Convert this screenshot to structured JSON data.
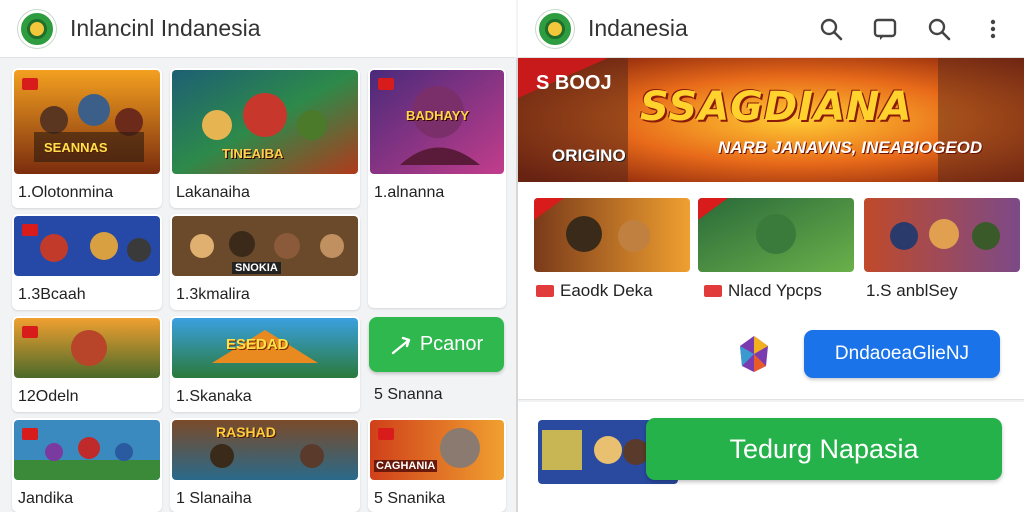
{
  "left_header": {
    "title": "Inlancinl Indanesia"
  },
  "right_header": {
    "title": "Indanesia"
  },
  "actions": [
    {
      "icon": "search-icon"
    },
    {
      "icon": "chat-icon"
    },
    {
      "icon": "search-icon"
    },
    {
      "icon": "more-vert-icon"
    }
  ],
  "grid": [
    {
      "label": "1.Olotonmina",
      "thumb_text": "SEANNAS"
    },
    {
      "label": "Lakanaiha",
      "thumb_text": "TINEAIBA"
    },
    {
      "label": "1.alnanna",
      "thumb_text": "BADHAYY"
    },
    {
      "label": "1.3Bcaah",
      "thumb_text": ""
    },
    {
      "label": "1.3kmalira",
      "thumb_text": "SNOKIA"
    },
    {
      "label": "12Odeln",
      "thumb_text": ""
    },
    {
      "label": "1.Skanaka",
      "thumb_text": "ESEDAD"
    },
    {
      "label": "5 Snanna",
      "thumb_text": ""
    },
    {
      "label": "Jandika",
      "thumb_text": ""
    },
    {
      "label": "1 Slanaiha",
      "thumb_text": "RASHAD"
    },
    {
      "label": "5 Snanika",
      "thumb_text": "CAGHANIA"
    }
  ],
  "play_button": {
    "label": "Pcanor"
  },
  "banner": {
    "tag": "S BOOJ",
    "title": "SSAGDIANA",
    "subtitle": "NARB JANAVNS, INEABIOGEOD",
    "corner": "ORIGINO"
  },
  "featured": [
    {
      "label": "Eaodk Deka"
    },
    {
      "label": "Nlacd Ypcps"
    },
    {
      "label": "1.S anblSey"
    }
  ],
  "blue_button": {
    "label": "DndaoeaGlieNJ"
  },
  "green_button": {
    "label": "Tedurg Napasia"
  },
  "colors": {
    "accent_green": "#2fb84e",
    "accent_blue": "#1a73e8",
    "badge_red": "#d81b1b"
  }
}
